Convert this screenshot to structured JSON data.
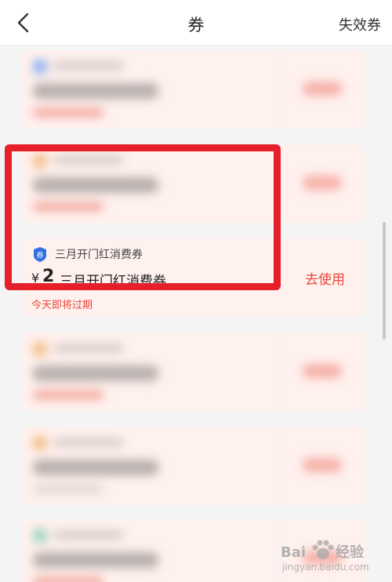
{
  "header": {
    "title": "券",
    "right_link": "失效券"
  },
  "coupon": {
    "icon_label": "券",
    "name": "三月开门红消费券",
    "currency": "¥",
    "amount": "2",
    "title": "三月开门红消费券",
    "expire_text": "今天即将过期",
    "action_label": "去使用"
  },
  "colors": {
    "accent": "#e8483a",
    "highlight_border": "#e5202b",
    "card_bg": "#fff1ee",
    "coupon_icon": "#2f6fe0"
  },
  "icons": {
    "back": "chevron-left-icon",
    "coupon": "coupon-badge-icon"
  },
  "watermark": {
    "brand": "Bai",
    "brand2": "经验",
    "sub": "jingyan.baidu.com"
  }
}
